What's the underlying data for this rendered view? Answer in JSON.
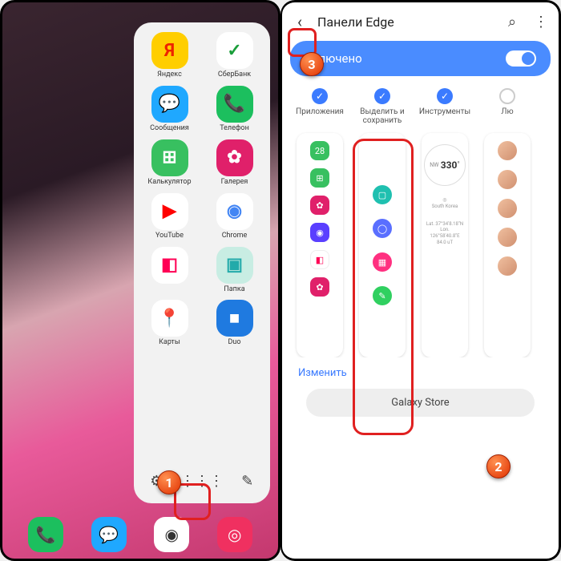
{
  "left": {
    "apps": [
      {
        "label": "Яндекс",
        "bg": "#ffce00",
        "glyph": "Я",
        "fg": "#e20"
      },
      {
        "label": "СберБанк",
        "bg": "#fff",
        "glyph": "✓",
        "fg": "#1a9e3a"
      },
      {
        "label": "Сообщения",
        "bg": "#1fa8ff",
        "glyph": "💬",
        "fg": "#fff"
      },
      {
        "label": "Телефон",
        "bg": "#1cbf5e",
        "glyph": "📞",
        "fg": "#fff"
      },
      {
        "label": "Калькулятор",
        "bg": "#38c060",
        "glyph": "⊞",
        "fg": "#fff"
      },
      {
        "label": "Галерея",
        "bg": "#e0206a",
        "glyph": "✿",
        "fg": "#fff"
      },
      {
        "label": "YouTube",
        "bg": "#fff",
        "glyph": "▶",
        "fg": "#f00"
      },
      {
        "label": "Chrome",
        "bg": "#fff",
        "glyph": "◉",
        "fg": "#4285f4"
      },
      {
        "label": "",
        "bg": "#fff",
        "glyph": "◧",
        "fg": "#f05"
      },
      {
        "label": "Папка",
        "bg": "#c8ede3",
        "glyph": "▣",
        "fg": "#2aa"
      },
      {
        "label": "Карты",
        "bg": "#fff",
        "glyph": "📍",
        "fg": "#34a853"
      },
      {
        "label": "Duo",
        "bg": "#1f7ae0",
        "glyph": "■",
        "fg": "#fff"
      }
    ],
    "tools": {
      "gear": "⚙",
      "grid": "⋮⋮⋮",
      "edit": "✎"
    }
  },
  "right": {
    "title": "Панели Edge",
    "enabled": "Включено",
    "panels": [
      {
        "label": "Приложения",
        "checked": true
      },
      {
        "label": "Выделить и сохранить",
        "checked": true
      },
      {
        "label": "Инструменты",
        "checked": true
      },
      {
        "label": "Лю",
        "checked": false
      }
    ],
    "compass": "330",
    "compass_dir": "NW",
    "location": "South Korea",
    "coords": "Lat. 37°34'8.18\"N\nLon. 126°58'40.8\"E\n84.0 uT",
    "edit": "Изменить",
    "store": "Galaxy Store"
  },
  "badges": {
    "1": "1",
    "2": "2",
    "3": "3"
  }
}
